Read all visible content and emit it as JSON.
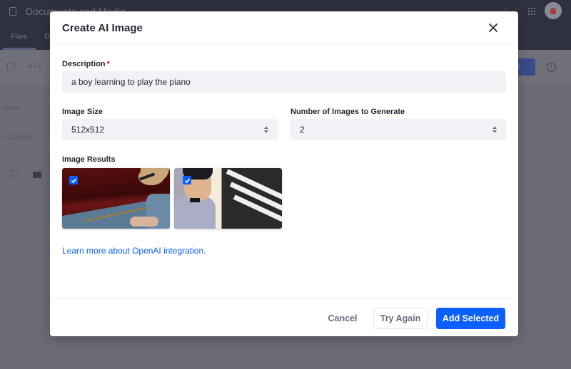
{
  "background": {
    "app_title": "Documents and Media",
    "tabs": [
      {
        "label": "Files",
        "active": true
      },
      {
        "label": "D",
        "active": false
      }
    ],
    "toolbar": {
      "filter_label": "Fil",
      "new_button_label": "N"
    },
    "sidebar_labels": {
      "home": "Home",
      "folders": "FOLDERS"
    },
    "icons": {
      "panel": "sidebar-toggle-icon",
      "apps": "apps-grid-icon",
      "avatar": "user-avatar-icon",
      "info": "info-icon",
      "folder": "folder-icon",
      "kebab": "vertical-ellipsis-icon"
    }
  },
  "modal": {
    "title": "Create AI Image",
    "close_icon": "close-icon",
    "description": {
      "label": "Description",
      "required_marker": "*",
      "value": "a boy learning to play the piano"
    },
    "image_size": {
      "label": "Image Size",
      "selected": "512x512"
    },
    "number_of_images": {
      "label": "Number of Images to Generate",
      "selected": "2"
    },
    "results": {
      "label": "Image Results",
      "images": [
        {
          "description": "boy with glasses playing piano",
          "selected": true
        },
        {
          "description": "boy in bow tie at piano",
          "selected": true
        }
      ]
    },
    "learn_more_link": "Learn more about OpenAI integration.",
    "footer": {
      "cancel_label": "Cancel",
      "try_again_label": "Try Again",
      "add_selected_label": "Add Selected"
    }
  },
  "colors": {
    "primary": "#0b5fff",
    "title_text": "#272833",
    "secondary_text": "#6b6c7e",
    "input_bg": "#f1f2f5",
    "required": "#da1414",
    "backdrop": "#6b6b75"
  }
}
